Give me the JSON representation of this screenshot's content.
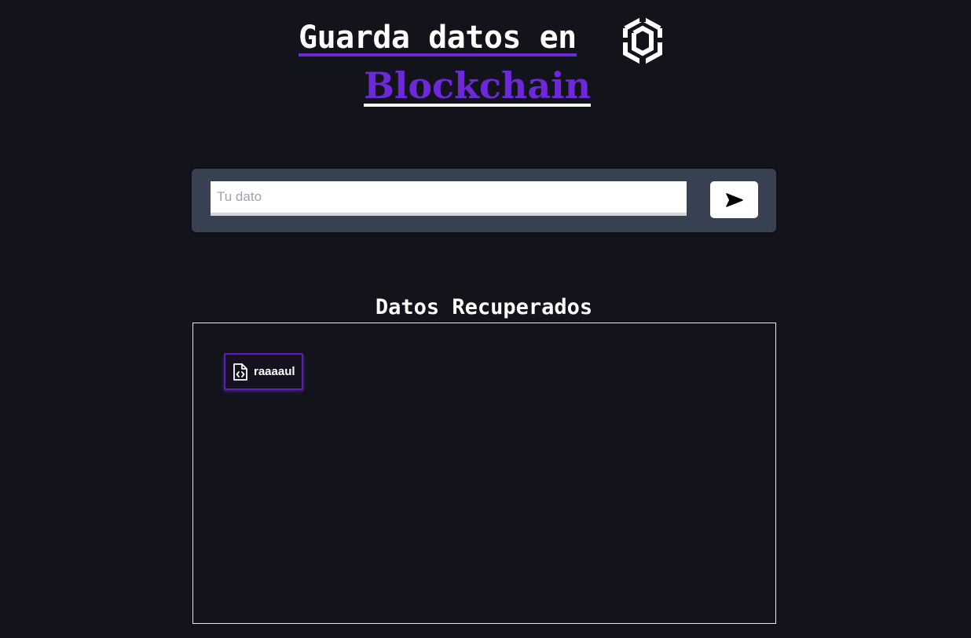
{
  "header": {
    "title_line1": "Guarda datos en",
    "title_line2": "Blockchain",
    "logo_icon": "bnb-chain-icon"
  },
  "form": {
    "input_placeholder": "Tu dato",
    "input_value": "",
    "send_icon": "send-arrow-icon"
  },
  "results": {
    "title": "Datos Recuperados",
    "items": [
      {
        "label": "raaaaul",
        "icon": "file-code-icon"
      }
    ]
  },
  "colors": {
    "background": "#13141b",
    "accent_purple": "#6d28d9",
    "card_gray": "#374151",
    "chip_border": "#5b21b6"
  }
}
